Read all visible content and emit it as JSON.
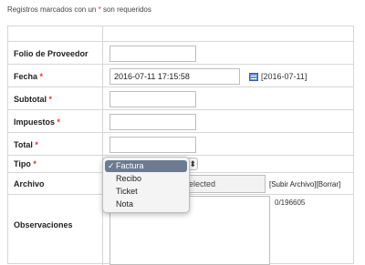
{
  "header": {
    "note_before": "Registros marcados con un ",
    "required_mark": "*",
    "note_after": " son requeridos"
  },
  "fields": {
    "folio": {
      "label": "Folio de Proveedor",
      "value": ""
    },
    "fecha": {
      "label": "Fecha",
      "required": "*",
      "value": "2016-07-11 17:15:58",
      "hint": "[2016-07-11]",
      "calendar_icon": "calendar-icon"
    },
    "subtotal": {
      "label": "Subtotal",
      "required": "*",
      "value": ""
    },
    "impuestos": {
      "label": "Impuestos",
      "required": "*",
      "value": ""
    },
    "total": {
      "label": "Total",
      "required": "*",
      "value": ""
    },
    "tipo": {
      "label": "Tipo",
      "required": "*",
      "selected": "Factura"
    },
    "archivo": {
      "label": "Archivo",
      "file_status": "elected",
      "upload_label": "[Subir Archivo]",
      "delete_label": "[Borrar]"
    },
    "observaciones": {
      "label": "Observaciones",
      "value": "",
      "counter": "0/196605"
    }
  },
  "tipo_dropdown": {
    "check": "✓",
    "options": [
      "Factura",
      "Recibo",
      "Ticket",
      "Nota"
    ]
  },
  "colors": {
    "required": "#dd3333",
    "selected_option": "#6c7b91"
  }
}
